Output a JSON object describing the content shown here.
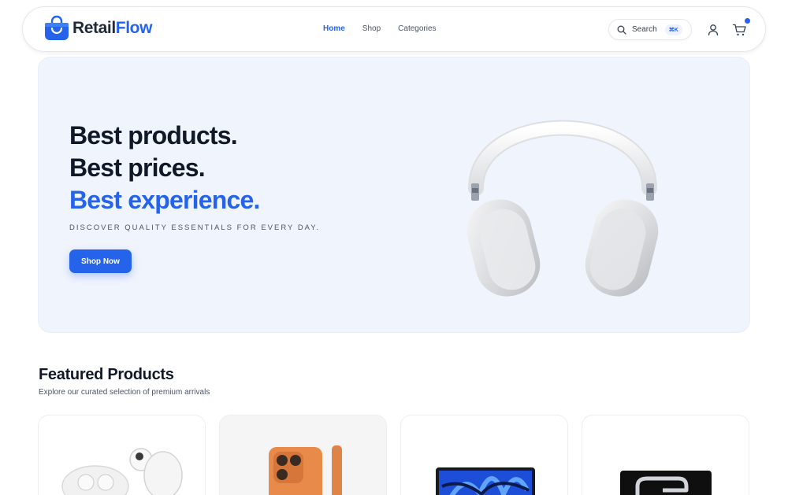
{
  "brand": {
    "name_part1": "Retail",
    "name_part2": "Flow",
    "accent": "#2563eb"
  },
  "nav": {
    "links": [
      {
        "label": "Home",
        "active": true
      },
      {
        "label": "Shop",
        "active": false
      },
      {
        "label": "Categories",
        "active": false
      }
    ],
    "search": {
      "label": "Search",
      "shortcut": "⌘K",
      "icon": "search-icon"
    },
    "icons": [
      "user-icon",
      "cart-icon"
    ],
    "cart_badge": "notification-dot"
  },
  "hero": {
    "title_line1": "Best products.",
    "title_line2": "Best prices.",
    "title_line3": "Best experience.",
    "subtitle": "DISCOVER QUALITY ESSENTIALS FOR EVERY DAY.",
    "cta": "Shop Now",
    "image": "headphones-image",
    "background": "#f0f4fd"
  },
  "featured": {
    "title": "Featured Products",
    "subtitle": "Explore our curated selection of premium arrivals",
    "products": [
      {
        "image": "earbuds-image"
      },
      {
        "image": "orange-phone-image"
      },
      {
        "image": "blue-laptop-image"
      },
      {
        "image": "black-laptop-image"
      }
    ]
  }
}
